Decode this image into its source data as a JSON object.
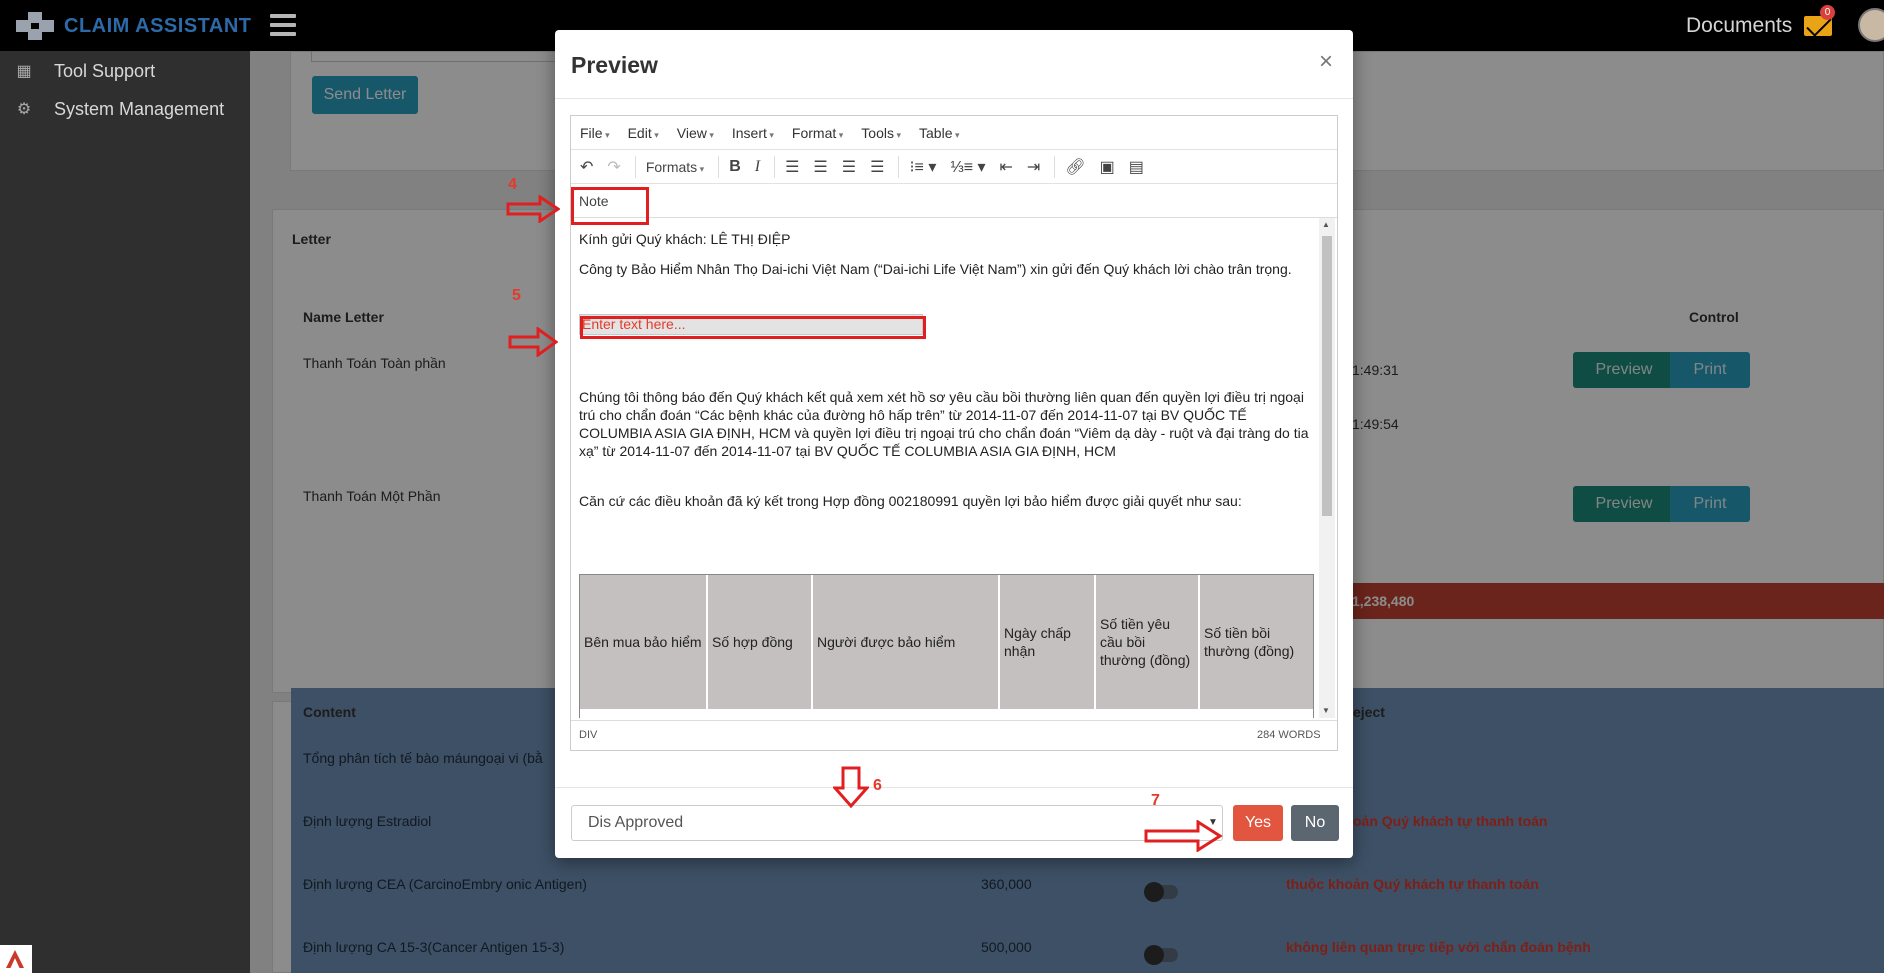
{
  "header": {
    "brand": "CLAIM ASSISTANT",
    "documents_label": "Documents",
    "mail_count": "0"
  },
  "sidebar": {
    "items": [
      {
        "label": "Tool Support",
        "icon": "calculator-icon"
      },
      {
        "label": "System Management",
        "icon": "gears-icon"
      }
    ]
  },
  "background": {
    "send_letter": "Send Letter",
    "letter_heading": "Letter",
    "col_name_letter": "Name Letter",
    "col_control": "Control",
    "rows": [
      {
        "name": "Thanh Toán Toàn phần",
        "time1": "1:49:31",
        "time2": "1:49:54"
      },
      {
        "name": "Thanh Toán Một Phần"
      }
    ],
    "preview_label": "Preview",
    "print_label": "Print",
    "total": "1,238,480",
    "content_heading": "Content",
    "reject_heading": "eject",
    "content_rows": [
      {
        "content": "Tổng phân tích tế bào máungoại vi (bằ",
        "amount": "",
        "reason": ""
      },
      {
        "content": "Định lượng Estradiol",
        "amount": "",
        "reason": "oản Quý khách tự thanh toán"
      },
      {
        "content": "Định lượng CEA (CarcinoEmbry onic Antigen)",
        "amount": "360,000",
        "reason": "thuộc khoản Quý khách tự thanh toán"
      },
      {
        "content": "Định lượng CA 15-3(Cancer Antigen 15-3)",
        "amount": "500,000",
        "reason": "không liên quan trực tiếp với chẩn đoán bệnh"
      }
    ]
  },
  "modal": {
    "title": "Preview",
    "close": "×",
    "menus": [
      "File",
      "Edit",
      "View",
      "Insert",
      "Format",
      "Tools",
      "Table"
    ],
    "formats_label": "Formats",
    "note_label": "Note",
    "salutation": "Kính gửi Quý khách:  LÊ THỊ ĐIỆP",
    "greeting": "Công ty Bảo Hiểm Nhân Thọ Dai-ichi Việt Nam (“Dai-ichi Life Việt Nam”) xin gửi đến Quý khách lời chào trân trọng.",
    "placeholder": "Enter text here...",
    "paragraph1": "Chúng tôi thông báo đến Quý khách kết quả xem xét hồ sơ yêu cầu bồi thường liên quan đến  quyền lợi điều trị ngoại trú cho chẩn đoán “Các bệnh khác của đường hô hấp trên” từ 2014-11-07 đến 2014-11-07 tại BV QUỐC TẾ COLUMBIA ASIA GIA ĐỊNH, HCM và quyền lợi điều trị ngoại trú cho chẩn đoán “Viêm dạ dày - ruột và đại tràng do tia xạ” từ 2014-11-07 đến 2014-11-07 tại BV QUỐC TẾ COLUMBIA ASIA GIA ĐỊNH, HCM",
    "paragraph2": "Căn cứ các điều khoản đã ký kết trong Hợp đồng  002180991  quyền lợi bảo hiểm được giải quyết như sau:",
    "table_headers": [
      "Bên mua bảo hiểm",
      "Số hợp đồng",
      "Người được bảo hiểm",
      "Ngày chấp nhận",
      "Số tiền yêu cầu bồi thường (đồng)",
      "Số tiền bồi thường (đồng)"
    ],
    "status_path": "DIV",
    "word_count": "284 WORDS",
    "select_value": "Dis Approved",
    "yes_label": "Yes",
    "no_label": "No"
  },
  "annotations": {
    "n4": "4",
    "n5": "5",
    "n6": "6",
    "n7": "7"
  },
  "colors": {
    "accent_teal": "#1d8a7a",
    "accent_blue": "#2a9fc1",
    "danger": "#e2553e",
    "annotation_red": "#e02020"
  }
}
